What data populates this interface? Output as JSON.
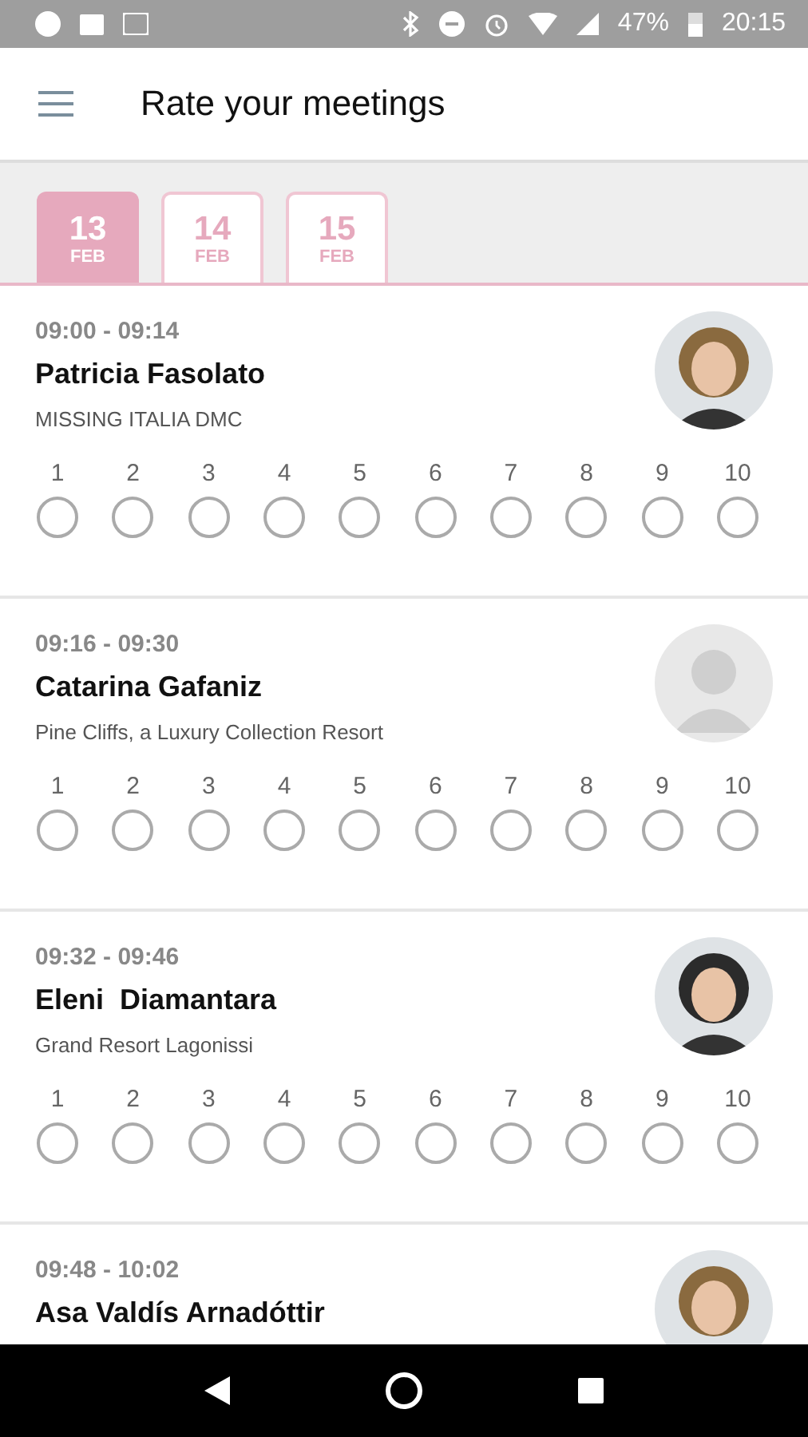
{
  "status_bar": {
    "battery": "47%",
    "time": "20:15"
  },
  "header": {
    "title": "Rate your meetings"
  },
  "days": [
    {
      "day": "13",
      "month": "FEB",
      "selected": true
    },
    {
      "day": "14",
      "month": "FEB",
      "selected": false
    },
    {
      "day": "15",
      "month": "FEB",
      "selected": false
    }
  ],
  "meetings": [
    {
      "time": "09:00 - 09:14",
      "name": "Patricia Fasolato",
      "company": "MISSING ITALIA DMC",
      "kind": "picture",
      "ratings": [
        {
          "label": "1",
          "selected": false
        },
        {
          "label": "2",
          "selected": false
        },
        {
          "label": "3",
          "selected": false
        },
        {
          "label": "4",
          "selected": false
        },
        {
          "label": "5",
          "selected": false
        },
        {
          "label": "6",
          "selected": false
        },
        {
          "label": "7",
          "selected": false
        },
        {
          "label": "8",
          "selected": false
        },
        {
          "label": "9",
          "selected": false
        },
        {
          "label": "10",
          "selected": false
        }
      ]
    },
    {
      "time": "09:16 - 09:30",
      "name": "Catarina Gafaniz",
      "company": "Pine Cliffs, a Luxury Collection Resort",
      "kind": "placeholder",
      "ratings": [
        {
          "label": "1",
          "selected": false
        },
        {
          "label": "2",
          "selected": false
        },
        {
          "label": "3",
          "selected": false
        },
        {
          "label": "4",
          "selected": false
        },
        {
          "label": "5",
          "selected": false
        },
        {
          "label": "6",
          "selected": false
        },
        {
          "label": "7",
          "selected": false
        },
        {
          "label": "8",
          "selected": false
        },
        {
          "label": "9",
          "selected": false
        },
        {
          "label": "10",
          "selected": false
        }
      ]
    },
    {
      "time": "09:32 - 09:46",
      "name": "Eleni  Diamantara",
      "company": "Grand Resort Lagonissi",
      "kind": "picture",
      "ratings": [
        {
          "label": "1",
          "selected": false
        },
        {
          "label": "2",
          "selected": false
        },
        {
          "label": "3",
          "selected": false
        },
        {
          "label": "4",
          "selected": false
        },
        {
          "label": "5",
          "selected": false
        },
        {
          "label": "6",
          "selected": false
        },
        {
          "label": "7",
          "selected": false
        },
        {
          "label": "8",
          "selected": false
        },
        {
          "label": "9",
          "selected": false
        },
        {
          "label": "10",
          "selected": false
        }
      ]
    },
    {
      "time": "09:48 - 10:02",
      "name": "Asa Valdís Arnadóttir",
      "kind": "picture"
    }
  ]
}
